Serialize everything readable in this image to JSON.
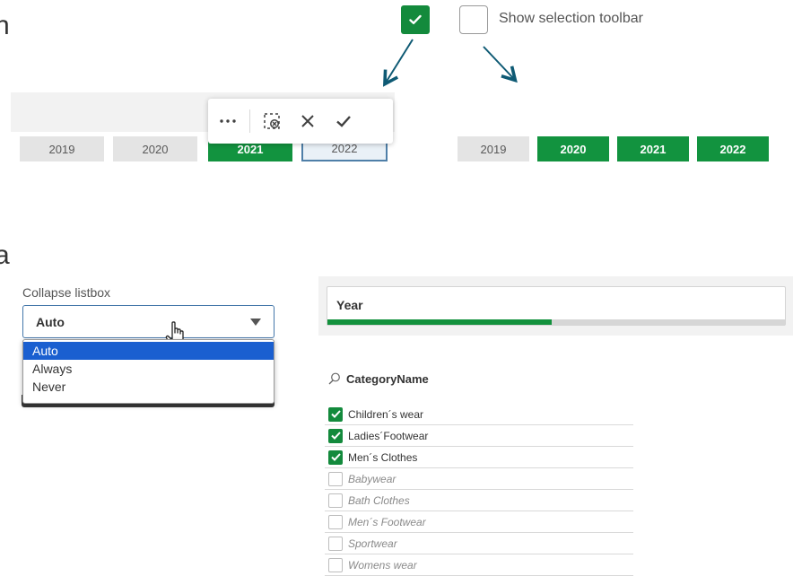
{
  "top_fragment": {
    "letter": "n"
  },
  "mid_fragment": {
    "letter": "a"
  },
  "legend": {
    "label": "Show selection toolbar",
    "arrow_color": "#0e5a74",
    "checked_color": "#138a3c"
  },
  "year_strip_left": {
    "chips": [
      {
        "label": "2019",
        "state": "plain"
      },
      {
        "label": "2020",
        "state": "plain"
      },
      {
        "label": "2021",
        "state": "selected"
      },
      {
        "label": "2022",
        "state": "pending"
      }
    ],
    "toolbar_icons": [
      "more-icon",
      "clear-selections-icon",
      "cancel-icon",
      "confirm-icon"
    ]
  },
  "year_strip_right": {
    "chips": [
      {
        "label": "2019",
        "state": "plain"
      },
      {
        "label": "2020",
        "state": "selected"
      },
      {
        "label": "2021",
        "state": "selected"
      },
      {
        "label": "2022",
        "state": "selected"
      }
    ]
  },
  "collapse": {
    "label": "Collapse listbox",
    "value": "Auto",
    "options": [
      "Auto",
      "Always",
      "Never"
    ],
    "selected_index": 0
  },
  "year_filter": {
    "title": "Year",
    "progress_fraction": 0.49
  },
  "category": {
    "title": "CategoryName",
    "items": [
      {
        "label": "Children´s wear",
        "selected": true
      },
      {
        "label": "Ladies´Footwear",
        "selected": true
      },
      {
        "label": "Men´s Clothes",
        "selected": true
      },
      {
        "label": "Babywear",
        "selected": false
      },
      {
        "label": "Bath Clothes",
        "selected": false
      },
      {
        "label": "Men´s Footwear",
        "selected": false
      },
      {
        "label": "Sportwear",
        "selected": false
      },
      {
        "label": "Womens wear",
        "selected": false
      }
    ]
  }
}
